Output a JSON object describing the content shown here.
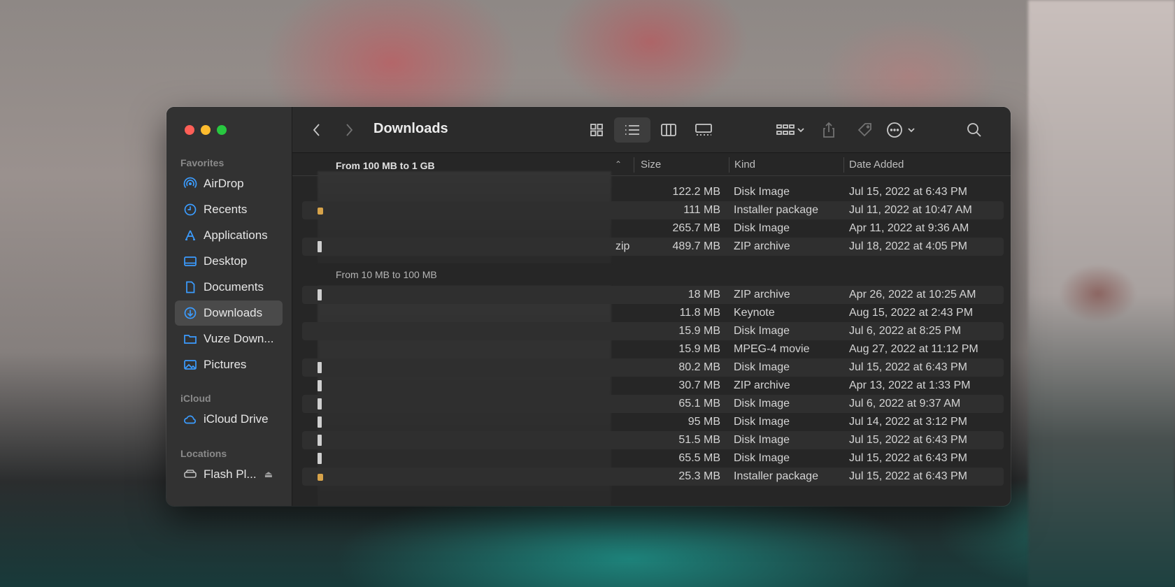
{
  "window": {
    "title": "Downloads"
  },
  "sidebar": {
    "sections": [
      {
        "label": "Favorites",
        "items": [
          {
            "label": "AirDrop",
            "icon": "airdrop-icon"
          },
          {
            "label": "Recents",
            "icon": "clock-icon"
          },
          {
            "label": "Applications",
            "icon": "applications-icon"
          },
          {
            "label": "Desktop",
            "icon": "desktop-icon"
          },
          {
            "label": "Documents",
            "icon": "document-icon"
          },
          {
            "label": "Downloads",
            "icon": "download-icon",
            "active": true
          },
          {
            "label": "Vuze Down...",
            "icon": "folder-icon"
          },
          {
            "label": "Pictures",
            "icon": "photo-icon"
          }
        ]
      },
      {
        "label": "iCloud",
        "items": [
          {
            "label": "iCloud Drive",
            "icon": "cloud-icon"
          }
        ]
      },
      {
        "label": "Locations",
        "items": [
          {
            "label": "Flash Pl...",
            "icon": "drive-icon"
          }
        ]
      }
    ]
  },
  "columns": {
    "size": "Size",
    "kind": "Kind",
    "date": "Date Added"
  },
  "groups": [
    {
      "label": "From 100 MB to 1 GB",
      "rows": [
        {
          "size": "122.2 MB",
          "kind": "Disk Image",
          "date": "Jul 15, 2022 at 6:43 PM"
        },
        {
          "size": "111 MB",
          "kind": "Installer package",
          "date": "Jul 11, 2022 at 10:47 AM"
        },
        {
          "size": "265.7 MB",
          "kind": "Disk Image",
          "date": "Apr 11, 2022 at 9:36 AM"
        },
        {
          "size": "489.7 MB",
          "kind": "ZIP archive",
          "date": "Jul 18, 2022 at 4:05 PM",
          "ext": "zip"
        }
      ]
    },
    {
      "label": "From 10 MB to 100 MB",
      "rows": [
        {
          "size": "18 MB",
          "kind": "ZIP archive",
          "date": "Apr 26, 2022 at 10:25 AM"
        },
        {
          "size": "11.8 MB",
          "kind": "Keynote",
          "date": "Aug 15, 2022 at 2:43 PM"
        },
        {
          "size": "15.9 MB",
          "kind": "Disk Image",
          "date": "Jul 6, 2022 at 8:25 PM"
        },
        {
          "size": "15.9 MB",
          "kind": "MPEG-4 movie",
          "date": "Aug 27, 2022 at 11:12 PM"
        },
        {
          "size": "80.2 MB",
          "kind": "Disk Image",
          "date": "Jul 15, 2022 at 6:43 PM"
        },
        {
          "size": "30.7 MB",
          "kind": "ZIP archive",
          "date": "Apr 13, 2022 at 1:33 PM"
        },
        {
          "size": "65.1 MB",
          "kind": "Disk Image",
          "date": "Jul 6, 2022 at 9:37 AM"
        },
        {
          "size": "95 MB",
          "kind": "Disk Image",
          "date": "Jul 14, 2022 at 3:12 PM"
        },
        {
          "size": "51.5 MB",
          "kind": "Disk Image",
          "date": "Jul 15, 2022 at 6:43 PM"
        },
        {
          "size": "65.5 MB",
          "kind": "Disk Image",
          "date": "Jul 15, 2022 at 6:43 PM"
        },
        {
          "size": "25.3 MB",
          "kind": "Installer package",
          "date": "Jul 15, 2022 at 6:43 PM"
        }
      ]
    }
  ]
}
